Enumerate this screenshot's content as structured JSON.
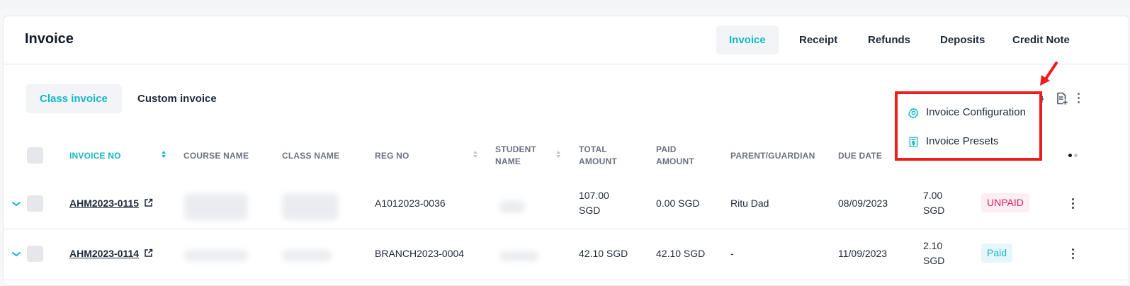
{
  "page": {
    "title": "Invoice"
  },
  "top_tabs": [
    {
      "label": "Invoice",
      "active": true
    },
    {
      "label": "Receipt",
      "active": false
    },
    {
      "label": "Refunds",
      "active": false
    },
    {
      "label": "Deposits",
      "active": false
    },
    {
      "label": "Credit Note",
      "active": false
    }
  ],
  "sub_tabs": [
    {
      "label": "Class invoice",
      "active": true
    },
    {
      "label": "Custom invoice",
      "active": false
    }
  ],
  "toolbar_icons": [
    "search-icon",
    "calendar-icon",
    "invoice-calc-icon",
    "filter-sliders-icon",
    "gear-icon",
    "add-document-icon",
    "more-vertical-icon"
  ],
  "columns": {
    "invoice_no": "INVOICE NO",
    "course_name": "COURSE NAME",
    "class_name": "CLASS NAME",
    "reg_no": "REG NO",
    "student_name": "STUDENT NAME",
    "total_amount": "TOTAL AMOUNT",
    "paid_amount": "PAID AMOUNT",
    "parent_guardian": "PARENT/GUARDIAN",
    "due_date": "DUE DATE"
  },
  "rows": [
    {
      "invoice_no": "AHM2023-0115",
      "reg_no": "A1012023-0036",
      "total_amount": "107.00 SGD",
      "paid_amount": "0.00 SGD",
      "parent": "Ritu Dad",
      "due_date": "08/09/2023",
      "balance": "7.00 SGD",
      "status": "UNPAID"
    },
    {
      "invoice_no": "AHM2023-0114",
      "reg_no": "BRANCH2023-0004",
      "total_amount": "42.10 SGD",
      "paid_amount": "42.10 SGD",
      "parent": "-",
      "due_date": "11/09/2023",
      "balance": "2.10 SGD",
      "status": "Paid"
    }
  ],
  "settings_menu": {
    "items": [
      {
        "label": "Invoice Configuration",
        "icon": "gear-icon"
      },
      {
        "label": "Invoice Presets",
        "icon": "invoice-preset-icon"
      }
    ]
  },
  "colors": {
    "accent": "#14b8c4",
    "highlight_border": "#ef1c1c",
    "unpaid": "#e11d61"
  }
}
